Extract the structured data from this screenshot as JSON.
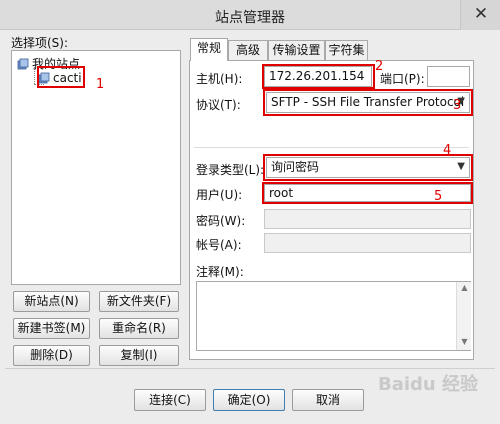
{
  "window": {
    "title": "站点管理器",
    "close_label": "✕"
  },
  "left": {
    "select_label": "选择项(S):",
    "tree": {
      "root": "我的站点",
      "child": "cacti"
    }
  },
  "left_buttons": {
    "new_site": "新站点(N)",
    "new_folder": "新文件夹(F)",
    "new_bookmark": "新建书签(M)",
    "rename": "重命名(R)",
    "delete": "删除(D)",
    "copy": "复制(I)"
  },
  "tabs": [
    {
      "label": "常规",
      "active": true
    },
    {
      "label": "高级",
      "active": false
    },
    {
      "label": "传输设置",
      "active": false
    },
    {
      "label": "字符集",
      "active": false
    }
  ],
  "form": {
    "host_label": "主机(H):",
    "host_value": "172.26.201.154",
    "port_label": "端口(P):",
    "port_value": "",
    "protocol_label": "协议(T):",
    "protocol_value": "SFTP - SSH File Transfer Protocol",
    "logon_type_label": "登录类型(L):",
    "logon_type_value": "询问密码",
    "user_label": "用户(U):",
    "user_value": "root",
    "password_label": "密码(W):",
    "account_label": "帐号(A):",
    "comments_label": "注释(M):"
  },
  "bottom_buttons": {
    "connect": "连接(C)",
    "ok": "确定(O)",
    "cancel": "取消"
  },
  "annotations": [
    "1",
    "2",
    "3",
    "4",
    "5"
  ],
  "watermark": "Baidu 经验",
  "colors": {
    "annotation_red": "#e00000",
    "window_bg": "#ececec"
  }
}
